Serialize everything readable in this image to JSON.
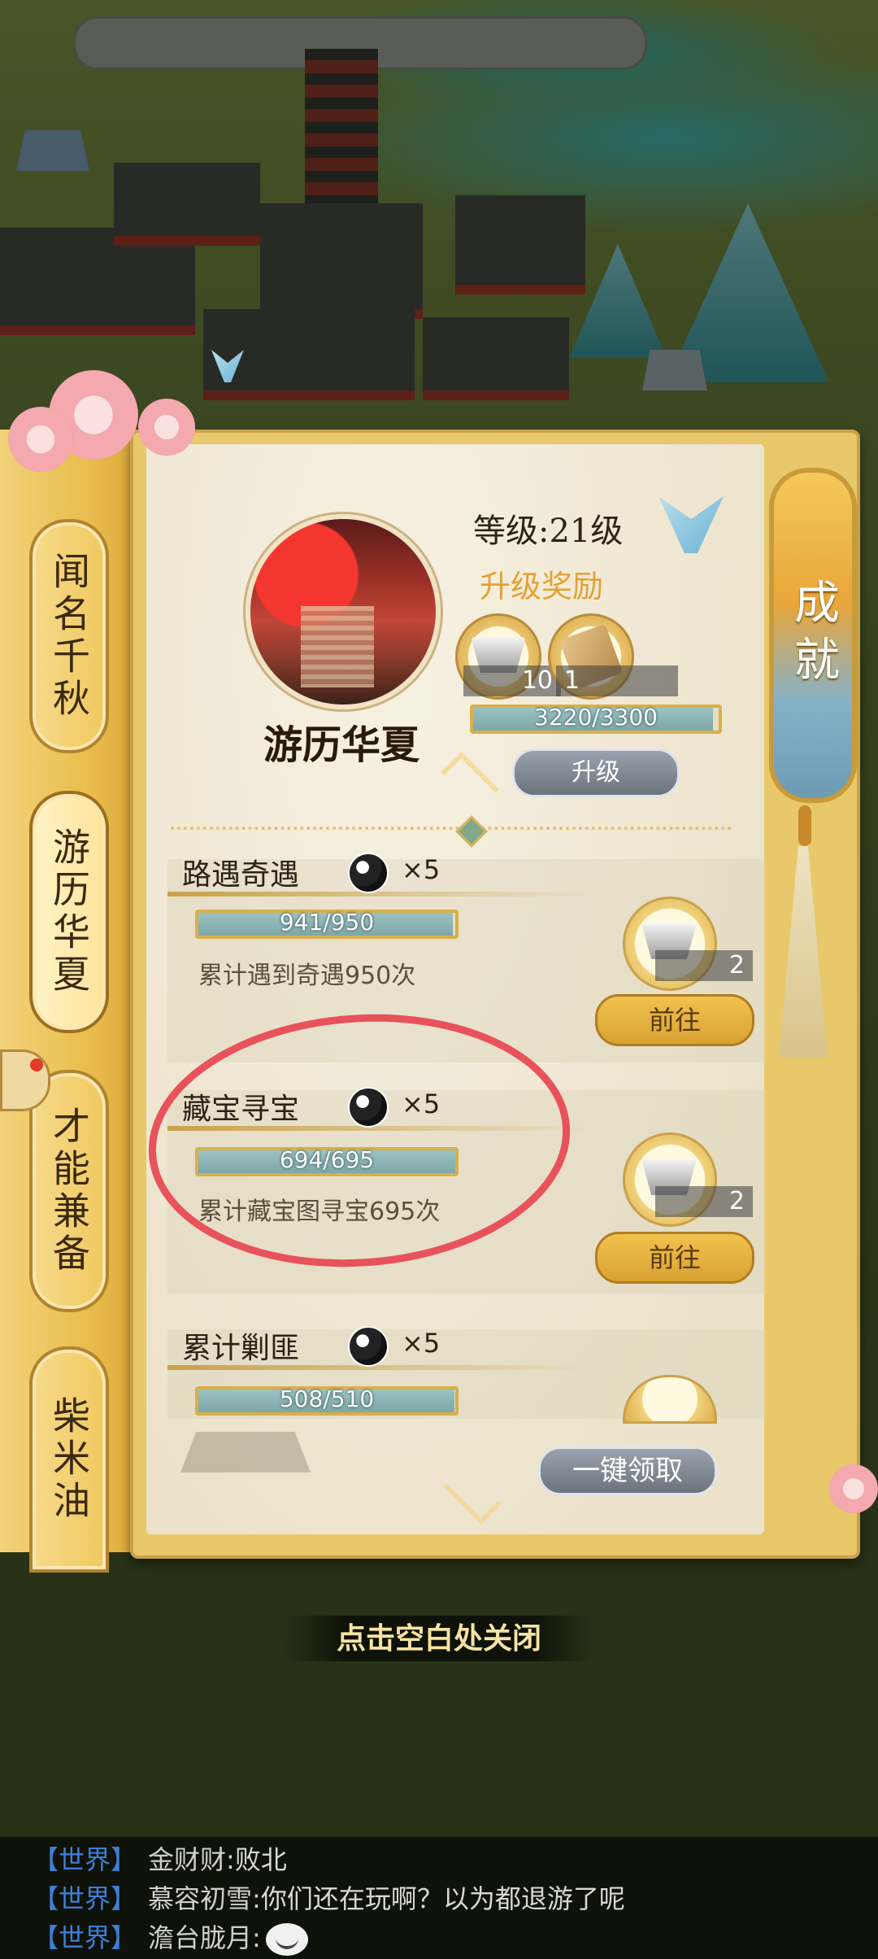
{
  "panel": {
    "tabs": [
      {
        "label": "闻名千秋"
      },
      {
        "label": "游历华夏"
      },
      {
        "label": "才能兼备"
      },
      {
        "label": "柴米油"
      }
    ],
    "side_scroll_label": "成就",
    "category_title": "游历华夏",
    "level_text": "等级:21级",
    "upgrade_reward_label": "升级奖励",
    "upgrade_rewards": [
      {
        "icon": "silver-ingot-icon",
        "count": "10"
      },
      {
        "icon": "scroll-icon",
        "count": "1"
      }
    ],
    "exp_progress": {
      "text": "3220/3300",
      "current": 3220,
      "max": 3300
    },
    "upgrade_button": "升级",
    "claim_all_button": "一键领取"
  },
  "achievements": [
    {
      "title": "路遇奇遇",
      "mult": "×5",
      "progress_text": "941/950",
      "current": 941,
      "max": 950,
      "description": "累计遇到奇遇950次",
      "reward_count": "2",
      "button": "前往"
    },
    {
      "title": "藏宝寻宝",
      "mult": "×5",
      "progress_text": "694/695",
      "current": 694,
      "max": 695,
      "description": "累计藏宝图寻宝695次",
      "reward_count": "2",
      "button": "前往"
    },
    {
      "title": "累计剿匪",
      "mult": "×5",
      "progress_text": "508/510",
      "current": 508,
      "max": 510
    }
  ],
  "close_hint": "点击空白处关闭",
  "chat": [
    {
      "channel": "【世界】",
      "name": "金财财:",
      "message": "败北"
    },
    {
      "channel": "【世界】",
      "name": "慕容初雪:",
      "message": "你们还在玩啊？以为都退游了呢"
    },
    {
      "channel": "【世界】",
      "name": "澹台胧月:",
      "message": ""
    }
  ],
  "colors": {
    "gold": "#e9bd4d",
    "progress_fill": "#8fb5b5",
    "highlight_circle": "#e8525a",
    "chat_channel": "#3d7fd7"
  }
}
